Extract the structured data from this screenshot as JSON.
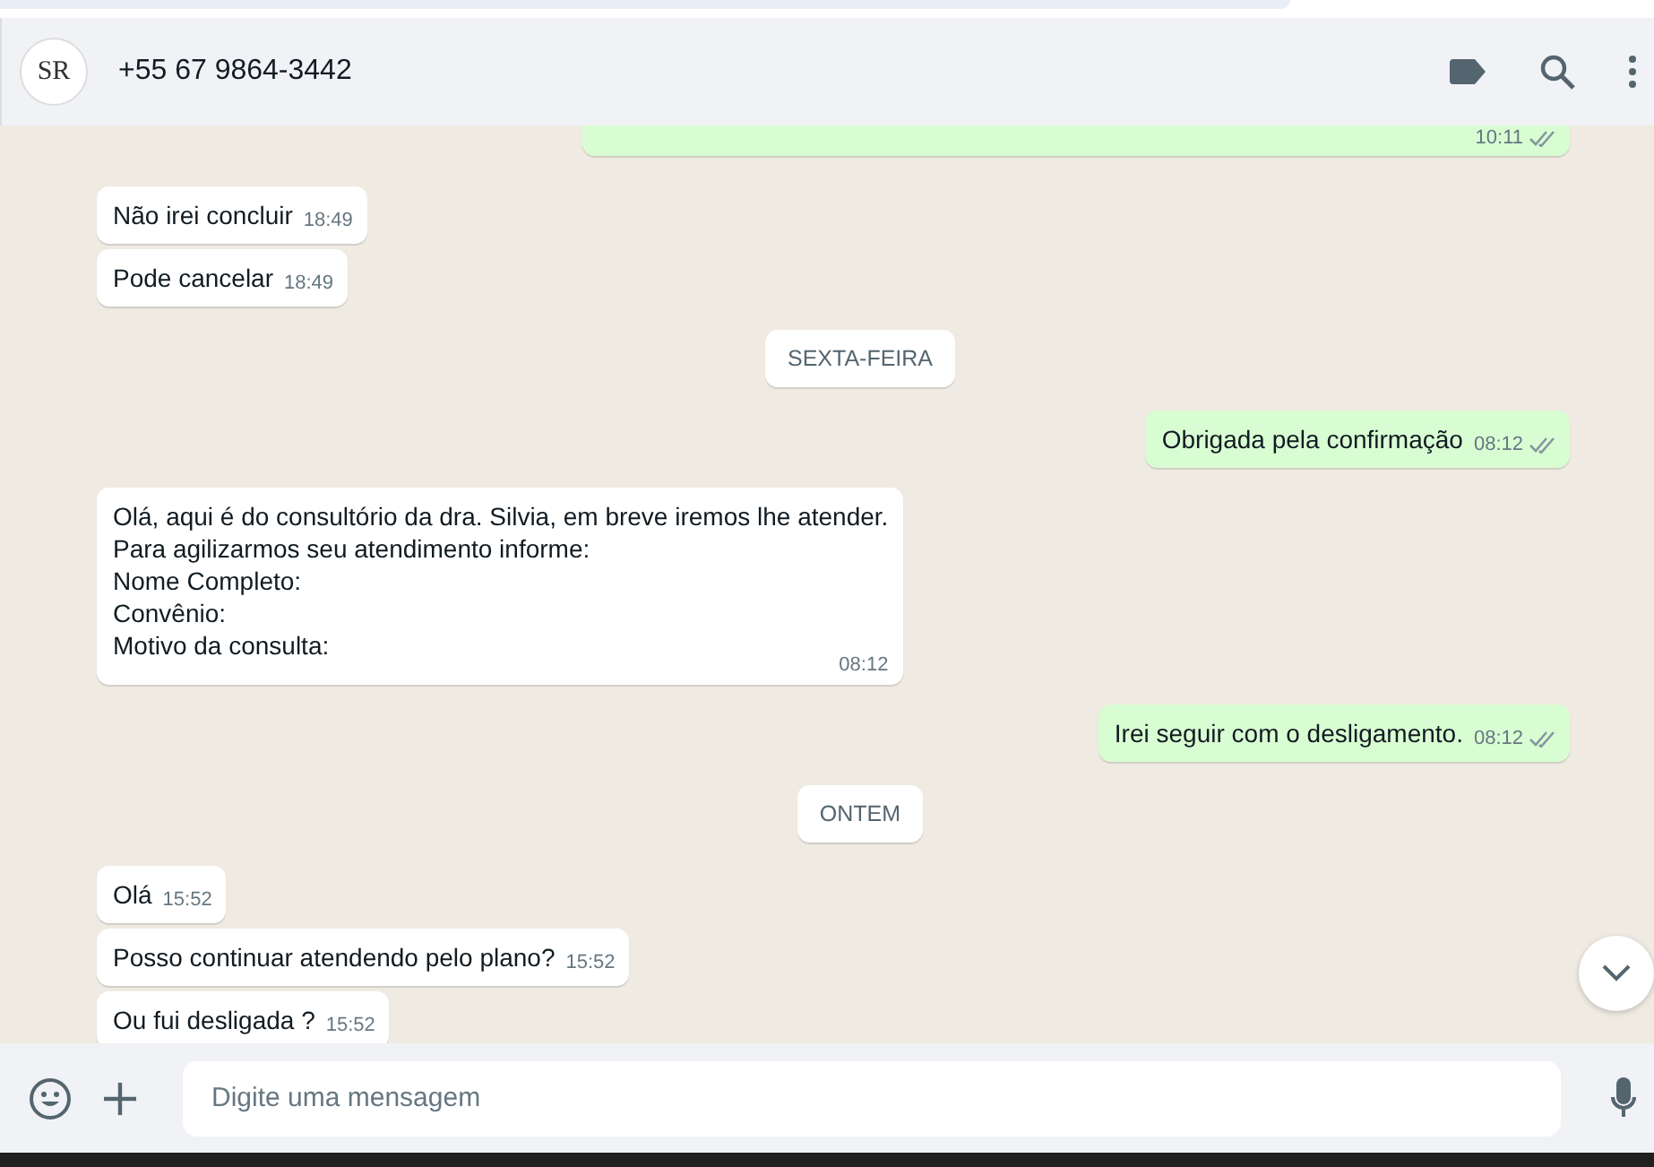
{
  "header": {
    "contact": "+55 67 9864-3442",
    "avatar_text": "SR"
  },
  "messages": [
    {
      "kind": "out",
      "time": "10:11",
      "read": false
    },
    {
      "kind": "in",
      "text": "Não irei concluir",
      "time": "18:49"
    },
    {
      "kind": "in",
      "text": "Pode cancelar",
      "time": "18:49"
    },
    {
      "kind": "date",
      "text": "SEXTA-FEIRA"
    },
    {
      "kind": "out",
      "text": "Obrigada pela confirmação",
      "time": "08:12",
      "read": false
    },
    {
      "kind": "in",
      "text": "Olá, aqui é do consultório da dra. Silvia, em breve iremos lhe atender.\nPara agilizarmos seu atendimento informe:\nNome Completo:\nConvênio:\nMotivo da consulta:",
      "time": "08:12"
    },
    {
      "kind": "out",
      "text": "Irei seguir com o desligamento.",
      "time": "08:12",
      "read": false
    },
    {
      "kind": "date",
      "text": "ONTEM"
    },
    {
      "kind": "in",
      "text": "Olá",
      "time": "15:52"
    },
    {
      "kind": "in",
      "text": "Posso continuar atendendo pelo plano?",
      "time": "15:52"
    },
    {
      "kind": "in",
      "text": "Ou fui desligada ?",
      "time": "15:52"
    }
  ],
  "composer": {
    "placeholder": "Digite uma mensagem"
  }
}
